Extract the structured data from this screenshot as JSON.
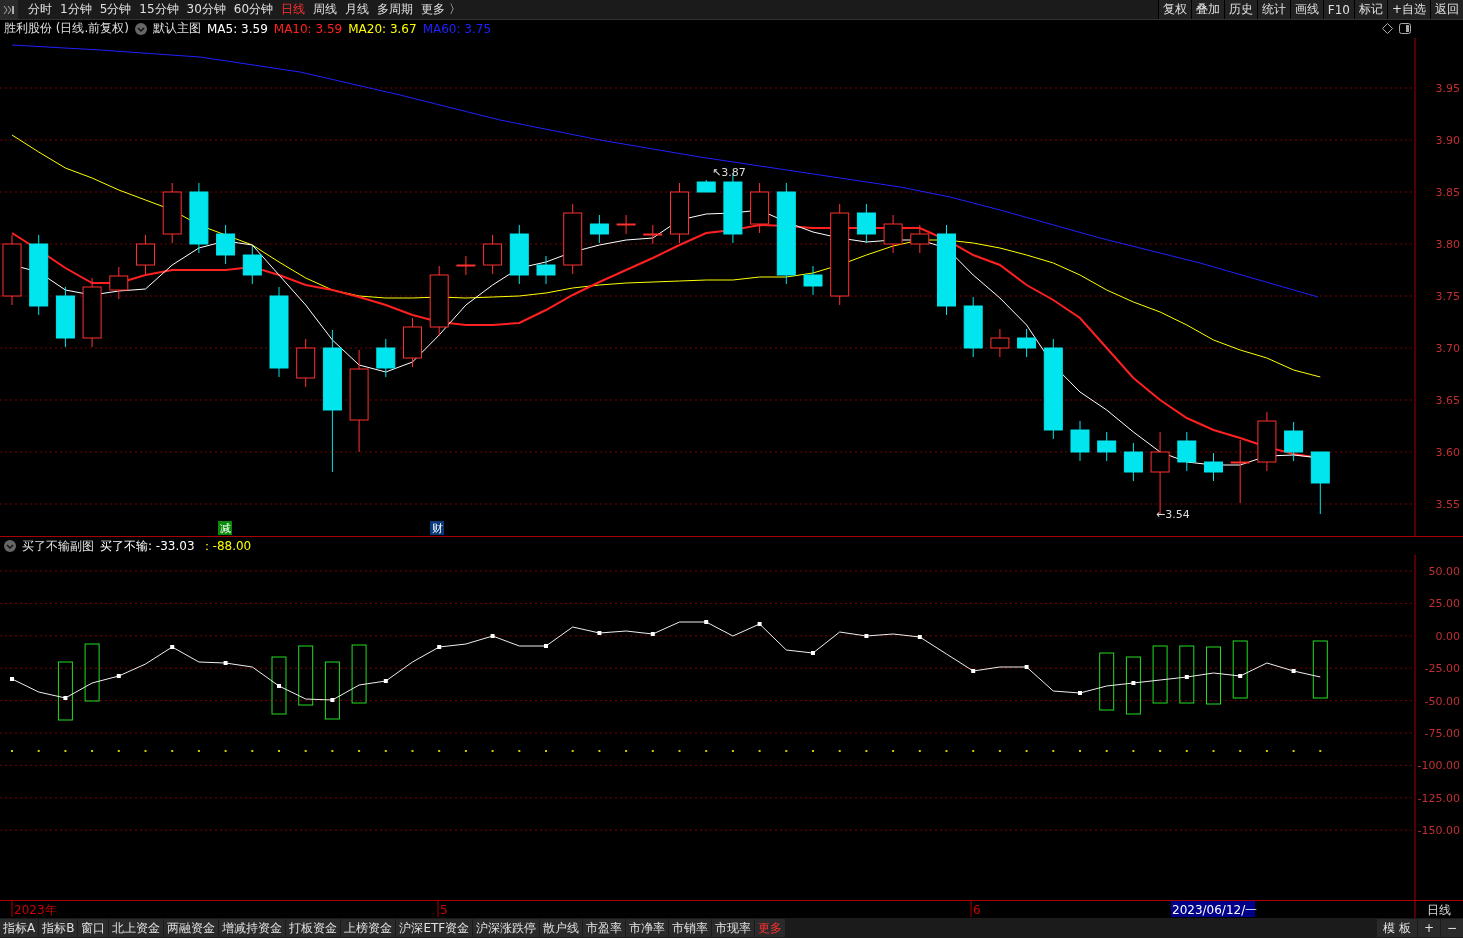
{
  "toolbar": {
    "periods": [
      {
        "label": "分时",
        "selected": false
      },
      {
        "label": "1分钟",
        "selected": false
      },
      {
        "label": "5分钟",
        "selected": false
      },
      {
        "label": "15分钟",
        "selected": false
      },
      {
        "label": "30分钟",
        "selected": false
      },
      {
        "label": "60分钟",
        "selected": false
      },
      {
        "label": "日线",
        "selected": true
      },
      {
        "label": "周线",
        "selected": false
      },
      {
        "label": "月线",
        "selected": false
      },
      {
        "label": "多周期",
        "selected": false
      },
      {
        "label": "更多 〉",
        "selected": false
      }
    ],
    "actions": [
      "复权",
      "叠加",
      "历史",
      "统计",
      "画线",
      "F10",
      "标记",
      "+自选",
      "返回"
    ]
  },
  "main_chart": {
    "title": "胜利股份 (日线.前复权)",
    "template": "默认主图",
    "indicators": [
      {
        "label": "MA5: 3.59",
        "color": "#ffffff"
      },
      {
        "label": "MA10: 3.59",
        "color": "#ff2020"
      },
      {
        "label": "MA20: 3.67",
        "color": "#ffff00"
      },
      {
        "label": "MA60: 3.75",
        "color": "#2020ff"
      }
    ],
    "y_labels": [
      "3.95",
      "3.90",
      "3.85",
      "3.80",
      "3.75",
      "3.70",
      "3.65",
      "3.60",
      "3.55"
    ],
    "high_label": "↖3.87",
    "low_label": "←3.54",
    "event_tags": [
      {
        "label": "减",
        "color": "#0a8a0a"
      },
      {
        "label": "财",
        "color": "#0a3a78"
      }
    ]
  },
  "sub_chart": {
    "title": "买了不输副图",
    "readings": [
      {
        "label": "买了不输: -33.03",
        "color": "#ffffff"
      },
      {
        "label": "：-88.00",
        "color": "#ffff00"
      }
    ],
    "y_labels": [
      "50.00",
      "25.00",
      "0.00",
      "-25.00",
      "-50.00",
      "-75.00",
      "-100.00",
      "-125.00",
      "-150.00"
    ]
  },
  "time_axis": {
    "labels": [
      "2023年",
      "5",
      "6"
    ],
    "cursor_date": "2023/06/12/一",
    "period": "日线"
  },
  "bottom_tabs": [
    {
      "label": "指标A",
      "selected": false
    },
    {
      "label": "指标B",
      "selected": false
    },
    {
      "label": "窗口",
      "selected": false
    },
    {
      "label": "北上资金",
      "selected": false
    },
    {
      "label": "两融资金",
      "selected": false
    },
    {
      "label": "增减持资金",
      "selected": false
    },
    {
      "label": "打板资金",
      "selected": false
    },
    {
      "label": "上榜资金",
      "selected": false
    },
    {
      "label": "沪深ETF资金",
      "selected": false
    },
    {
      "label": "沪深涨跌停",
      "selected": false
    },
    {
      "label": "散户线",
      "selected": false
    },
    {
      "label": "市盈率",
      "selected": false
    },
    {
      "label": "市净率",
      "selected": false
    },
    {
      "label": "市销率",
      "selected": false
    },
    {
      "label": "市现率",
      "selected": false
    },
    {
      "label": "更多",
      "selected": true
    }
  ],
  "bottom_right": [
    "模 板",
    "+",
    "−"
  ]
}
